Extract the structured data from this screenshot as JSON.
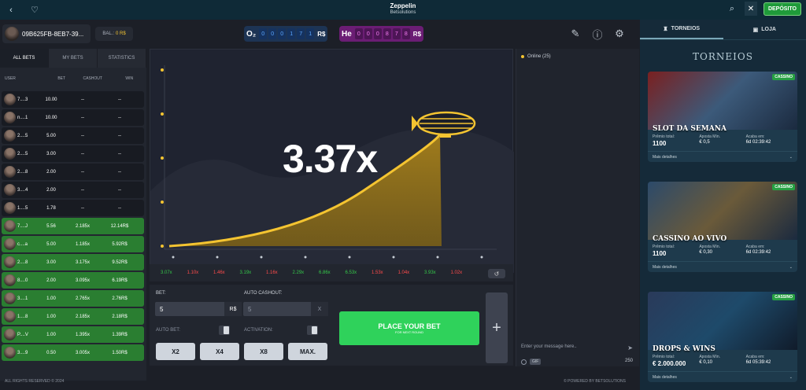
{
  "topbar": {
    "title": "Zeppelin",
    "subtitle": "Betsolutions",
    "deposit_label": "DEPÓSITO"
  },
  "header": {
    "user_id": "09B625FB-8EB7-39...",
    "balance_label": "BAL.:",
    "balance_value": "0 R$",
    "history1": {
      "label": "O₂",
      "digits": [
        "0",
        "0",
        "0",
        "1",
        "7",
        "1"
      ],
      "currency": "R$"
    },
    "history2": {
      "label": "He",
      "digits": [
        "0",
        "0",
        "0",
        "8",
        "7",
        "8"
      ],
      "currency": "R$"
    }
  },
  "bets": {
    "tabs": [
      "ALL BETS",
      "MY BETS",
      "STATISTICS"
    ],
    "columns": [
      "USER",
      "BET",
      "CASHOUT",
      "WIN"
    ],
    "rows": [
      {
        "user": "7....3",
        "bet": "10.00",
        "cashout": "--",
        "win": "--",
        "won": false
      },
      {
        "user": "n....1",
        "bet": "10.00",
        "cashout": "--",
        "win": "--",
        "won": false
      },
      {
        "user": "2....5",
        "bet": "5.00",
        "cashout": "--",
        "win": "--",
        "won": false
      },
      {
        "user": "2....5",
        "bet": "3.00",
        "cashout": "--",
        "win": "--",
        "won": false
      },
      {
        "user": "2....8",
        "bet": "2.00",
        "cashout": "--",
        "win": "--",
        "won": false
      },
      {
        "user": "3....4",
        "bet": "2.00",
        "cashout": "--",
        "win": "--",
        "won": false
      },
      {
        "user": "1....5",
        "bet": "1.78",
        "cashout": "--",
        "win": "--",
        "won": false
      },
      {
        "user": "7....J",
        "bet": "5.56",
        "cashout": "2.185x",
        "win": "12.14R$",
        "won": true
      },
      {
        "user": "c....a",
        "bet": "5.00",
        "cashout": "1.185x",
        "win": "5.92R$",
        "won": true
      },
      {
        "user": "2....8",
        "bet": "3.00",
        "cashout": "3.175x",
        "win": "9.52R$",
        "won": true
      },
      {
        "user": "8....0",
        "bet": "2.00",
        "cashout": "3.095x",
        "win": "6.19R$",
        "won": true
      },
      {
        "user": "3....1",
        "bet": "1.00",
        "cashout": "2.765x",
        "win": "2.76R$",
        "won": true
      },
      {
        "user": "1....8",
        "bet": "1.00",
        "cashout": "2.185x",
        "win": "2.18R$",
        "won": true
      },
      {
        "user": "P....V",
        "bet": "1.00",
        "cashout": "1.395x",
        "win": "1.39R$",
        "won": true
      },
      {
        "user": "3....9",
        "bet": "0.50",
        "cashout": "3.005x",
        "win": "1.50R$",
        "won": true
      }
    ]
  },
  "graph": {
    "multiplier": "3.37x",
    "curve_color": "#f4c431"
  },
  "history_values": [
    {
      "v": "3.07x",
      "color": "#35c84a"
    },
    {
      "v": "1.10x",
      "color": "#ff4b4b"
    },
    {
      "v": "1.46x",
      "color": "#ff4b4b"
    },
    {
      "v": "3.19x",
      "color": "#35c84a"
    },
    {
      "v": "1.16x",
      "color": "#ff4b4b"
    },
    {
      "v": "2.29x",
      "color": "#35c84a"
    },
    {
      "v": "6.86x",
      "color": "#35c84a"
    },
    {
      "v": "6.53x",
      "color": "#35c84a"
    },
    {
      "v": "1.53x",
      "color": "#ff4b4b"
    },
    {
      "v": "1.04x",
      "color": "#ff4b4b"
    },
    {
      "v": "3.93x",
      "color": "#35c84a"
    },
    {
      "v": "1.02x",
      "color": "#ff4b4b"
    }
  ],
  "betpanel": {
    "bet_label": "BET:",
    "bet_value": "5",
    "bet_currency": "R$",
    "auto_cashout_label": "AUTO CASHOUT:",
    "auto_cashout_value": "5",
    "auto_cashout_clear": "X",
    "auto_bet_label": "AUTO BET:",
    "activation_label": "ACTIVATION:",
    "quick": [
      "X2",
      "X4",
      "X8",
      "MAX."
    ],
    "place_label": "PLACE YOUR BET",
    "place_sub": "FOR NEXT ROUND"
  },
  "chat": {
    "online": "Online (25)",
    "placeholder": "Enter your message here..",
    "gif": "GIF",
    "chars": "250"
  },
  "footer": {
    "left": "ALL RIGHTS RESERVED © 2024",
    "right": "© POWERED BY BETSOLUTIONS"
  },
  "side": {
    "tabs": [
      "TORNEIOS",
      "LOJA"
    ],
    "title": "TORNEIOS",
    "cards": [
      {
        "tag": "CASSINO",
        "title": "SLOT DA SEMANA",
        "prize_label": "Prêmio total:",
        "prize": "1100",
        "min_label": "Aposta Mín.",
        "min": "€ 0,5",
        "ends_label": "Acaba em:",
        "ends": "6d 02:39:42",
        "more": "Mais detalhes"
      },
      {
        "tag": "CASSINO",
        "title": "CASSINO AO VIVO",
        "prize_label": "Prêmio total:",
        "prize": "1100",
        "min_label": "Aposta Mín.",
        "min": "€ 0,30",
        "ends_label": "Acaba em:",
        "ends": "6d 02:39:42",
        "more": "Mais detalhes"
      },
      {
        "tag": "CASSINO",
        "title": "DROPS & WINS",
        "prize_label": "Prêmio total:",
        "prize": "€ 2.000.000",
        "min_label": "Aposta Mín.",
        "min": "€ 0,10",
        "ends_label": "Acaba em:",
        "ends": "6d 05:39:42",
        "more": "Mais detalhes"
      }
    ]
  }
}
